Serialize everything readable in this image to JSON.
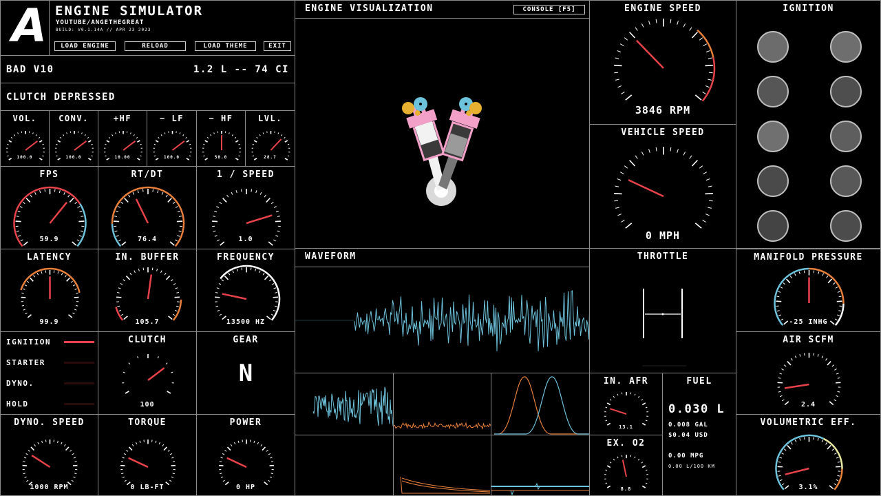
{
  "header": {
    "logo": "A",
    "app_title": "ENGINE SIMULATOR",
    "channel": "YOUTUBE/ANGETHEGREAT",
    "build": "BUILD: V0.1.14A // APR 23 2023",
    "buttons": {
      "load_engine": "LOAD ENGINE",
      "reload": "RELOAD",
      "load_theme": "LOAD THEME",
      "exit": "EXIT"
    }
  },
  "engine": {
    "name": "BAD V10",
    "displacement": "1.2 L -- 74 CI",
    "status": "CLUTCH DEPRESSED"
  },
  "audio_gauges": [
    {
      "label": "VOL.",
      "value": "100.0",
      "fraction": 0.72
    },
    {
      "label": "CONV.",
      "value": "100.0",
      "fraction": 0.72
    },
    {
      "label": "+HF",
      "value": "10.00",
      "fraction": 0.72
    },
    {
      "label": "~ LF",
      "value": "100.0",
      "fraction": 0.72
    },
    {
      "label": "~ HF",
      "value": "50.0",
      "fraction": 0.5
    },
    {
      "label": "LVL.",
      "value": "28.7",
      "fraction": 0.68
    }
  ],
  "perf": {
    "fps": {
      "label": "FPS",
      "value": "59.9",
      "fraction": 0.65
    },
    "rtdt": {
      "label": "RT/DT",
      "value": "76.4",
      "fraction": 0.4
    },
    "inv_speed": {
      "label": "1 / SPEED",
      "value": "1.0",
      "fraction": 0.78
    },
    "latency": {
      "label": "LATENCY",
      "value": "99.9",
      "fraction": 0.5
    },
    "in_buffer": {
      "label": "IN. BUFFER",
      "value": "105.7",
      "fraction": 0.53
    },
    "frequency": {
      "label": "FREQUENCY",
      "value": "13500 HZ",
      "fraction": 0.2
    }
  },
  "indicators": [
    {
      "label": "IGNITION",
      "on": true
    },
    {
      "label": "STARTER",
      "on": false
    },
    {
      "label": "DYNO.",
      "on": false
    },
    {
      "label": "HOLD",
      "on": false
    }
  ],
  "clutch": {
    "label": "CLUTCH",
    "value": "100",
    "fraction": 0.72
  },
  "gear": {
    "label": "GEAR",
    "value": "N"
  },
  "dyno": {
    "speed": {
      "label": "DYNO. SPEED",
      "value": "1000 RPM",
      "fraction": 0.28
    },
    "torque": {
      "label": "TORQUE",
      "value": "0 LB-FT",
      "fraction": 0.25
    },
    "power": {
      "label": "POWER",
      "value": "0 HP",
      "fraction": 0.25
    }
  },
  "visualization": {
    "title": "ENGINE VISUALIZATION",
    "console_button": "CONSOLE [F5]"
  },
  "waveform": {
    "title": "WAVEFORM"
  },
  "engine_speed": {
    "label": "ENGINE SPEED",
    "value": "3846 RPM",
    "fraction": 0.33
  },
  "vehicle_speed": {
    "label": "VEHICLE SPEED",
    "value": "0 MPH",
    "fraction": 0.25
  },
  "throttle": {
    "label": "THROTTLE"
  },
  "afr": {
    "label": "IN. AFR",
    "value": "13.1",
    "fraction": 0.2
  },
  "ex_o2": {
    "label": "EX. O2",
    "value": "8.8",
    "fraction": 0.45
  },
  "fuel": {
    "label": "FUEL",
    "liters": "0.030 L",
    "gal": "0.008 GAL",
    "usd": "$0.04 USD",
    "mpg": "0.00 MPG",
    "l100": "0.00 L/100 KM"
  },
  "ignition": {
    "label": "IGNITION",
    "cylinders": 10
  },
  "manifold": {
    "label": "MANIFOLD PRESSURE",
    "value": "-25 INHG",
    "fraction": 0.5
  },
  "air_scfm": {
    "label": "AIR SCFM",
    "value": "2.4",
    "fraction": 0.12
  },
  "vol_eff": {
    "label": "VOLUMETRIC EFF.",
    "value": "3.1%",
    "fraction": 0.1
  },
  "colors": {
    "accent": "#e8424a",
    "orange": "#e8803a",
    "blue": "#6ec3dc",
    "grid": "#8a8a8a"
  }
}
